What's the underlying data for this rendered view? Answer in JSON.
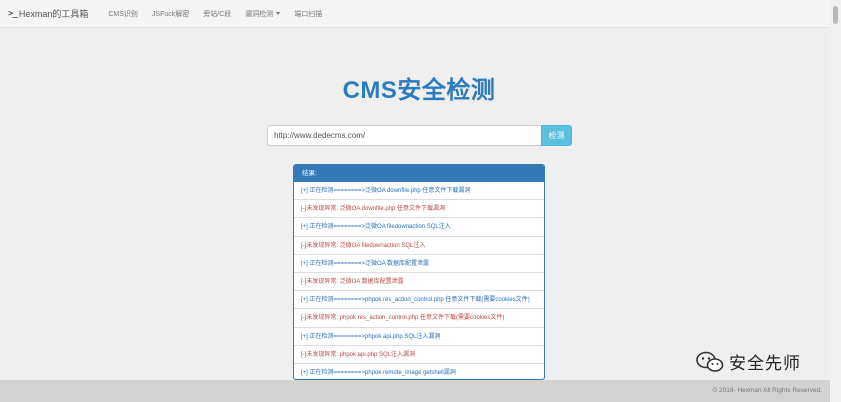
{
  "navbar": {
    "brand": "Hexman的工具箱",
    "items": [
      "CMS识别",
      "JSFuck解密",
      "旁站/C段",
      "漏洞检测",
      "端口扫描"
    ]
  },
  "main": {
    "title": "CMS安全检测",
    "url_input_value": "http://www.dedecms.com/",
    "detect_button": "检测",
    "results_heading": "结果:",
    "results": [
      "[+] 正在检测========>泛微OA downfile.php 任意文件下载漏洞",
      "[-]未发现异常:  泛微OA downfile.php 任意文件下载漏洞",
      "[+] 正在检测========>泛微OA filedownaction SQL注入",
      "[-]未发现异常:  泛微OA filedownaction SQL注入",
      "[+] 正在检测========>泛微OA 数据库配置泄露",
      "[-]未发现异常:  泛微OA 数据库配置泄露",
      "[+] 正在检测========>phpok res_action_control.php 任意文件下载(需要cookies文件)",
      "[-]未发现异常:  phpok res_action_control.php 任意文件下载(需要cookies文件)",
      "[+] 正在检测========>phpok api.php SQL注入漏洞",
      "[-]未发现异常:  phpok api.php SQL注入漏洞",
      "[+] 正在检测========>phpok remote_image getshell漏洞"
    ]
  },
  "footer": {
    "copyright": "© 2018- Hexman All Rights Reserved."
  },
  "watermark": {
    "text": "安全先师"
  },
  "colors": {
    "title": "#2e7abf",
    "panel": "#337ab7",
    "button": "#5bc0de",
    "info_text": "#2a6ebb",
    "warn_text": "#b94a48"
  }
}
